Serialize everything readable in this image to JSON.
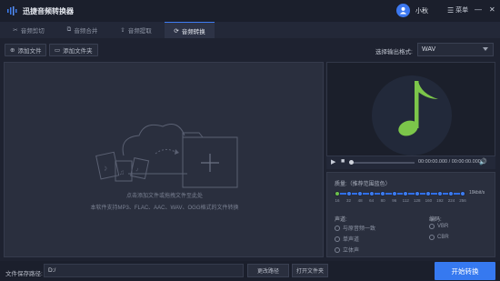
{
  "app": {
    "title": "迅捷音频转换器"
  },
  "user": {
    "name": "小秋"
  },
  "window": {
    "menu_label": "菜单"
  },
  "tabs": [
    {
      "label": "音频剪切",
      "icon": "scissors-icon"
    },
    {
      "label": "音频合并",
      "icon": "merge-icon"
    },
    {
      "label": "音频提取",
      "icon": "extract-icon"
    },
    {
      "label": "音频转换",
      "icon": "convert-icon",
      "active": true
    }
  ],
  "toolbar": {
    "add_file_label": "添加文件",
    "add_folder_label": "添加文件夹",
    "format_label": "选择输出格式:",
    "format_value": "WAV"
  },
  "dropzone": {
    "hint_line1": "点击添加文件或拖拽文件至此处",
    "hint_line2": "本软件支持MP3、FLAC、AAC、WAV、OGG格式的文件转换"
  },
  "player": {
    "timecode": "00:00:00.000 / 00:00:00.000"
  },
  "settings": {
    "bitrate_label": "质量:（推荐范围蓝色）",
    "bitrate_unit": "19kbit/s",
    "bitrate_ticks": [
      "16",
      "32",
      "48",
      "64",
      "80",
      "96",
      "112",
      "128",
      "160",
      "192",
      "224",
      "256"
    ],
    "bitrate_selected_index": 0,
    "channel_label": "声道:",
    "channel_options": [
      "与原音频一致",
      "单声道",
      "立体声"
    ],
    "encoding_label": "编码:",
    "encoding_options": [
      "VBR",
      "CBR"
    ]
  },
  "bottom": {
    "path_label": "文件保存路径:",
    "path_value": "D:/",
    "change_path_label": "更改路径",
    "open_folder_label": "打开文件夹",
    "start_label": "开始转换"
  },
  "colors": {
    "accent": "#3679f0",
    "note": "#7cc64a",
    "background": "#1e2230"
  }
}
